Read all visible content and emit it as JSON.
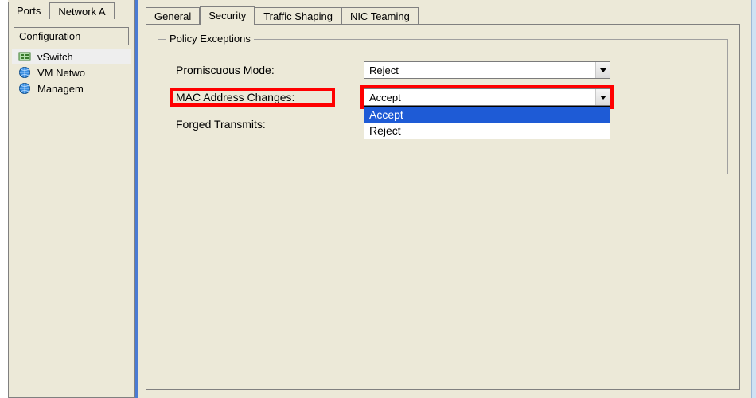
{
  "left": {
    "tabs": [
      "Ports",
      "Network A"
    ],
    "config_header": "Configuration",
    "items": [
      {
        "label": "vSwitch",
        "icon": "vswitch-icon",
        "selected": true
      },
      {
        "label": "VM Netwo",
        "icon": "globe-icon",
        "selected": false
      },
      {
        "label": "Managem",
        "icon": "globe-icon",
        "selected": false
      }
    ]
  },
  "dialog": {
    "tabs": [
      "General",
      "Security",
      "Traffic Shaping",
      "NIC Teaming"
    ],
    "active_tab": "Security",
    "group_title": "Policy Exceptions",
    "rows": [
      {
        "label": "Promiscuous Mode:",
        "value": "Reject",
        "highlight": false,
        "open": false
      },
      {
        "label": "MAC Address Changes:",
        "value": "Accept",
        "highlight": true,
        "open": true
      },
      {
        "label": "Forged Transmits:",
        "value": "",
        "highlight": false,
        "open": false
      }
    ],
    "dropdown_items": [
      "Accept",
      "Reject"
    ],
    "dropdown_selected": "Accept"
  }
}
